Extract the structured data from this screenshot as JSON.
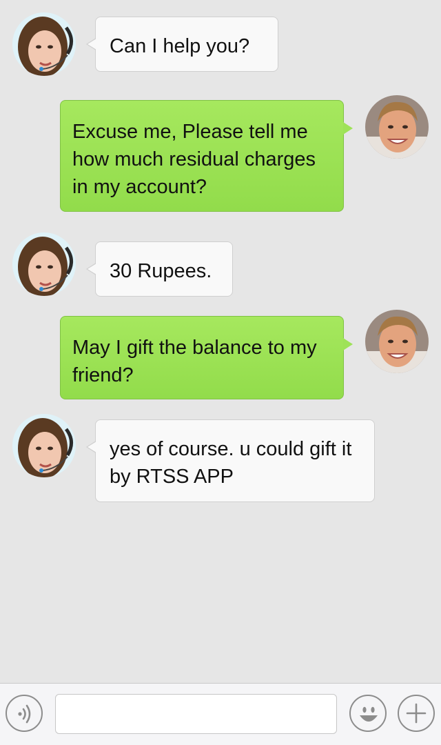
{
  "chat": {
    "messages": [
      {
        "sender": "agent",
        "text": "Can I help you?"
      },
      {
        "sender": "user",
        "text": "Excuse me, Please tell me how much residual charges in my account?"
      },
      {
        "sender": "agent",
        "text": "30 Rupees."
      },
      {
        "sender": "user",
        "text": "May I gift the balance to my friend?"
      },
      {
        "sender": "agent",
        "text": "yes of course. u could gift it by RTSS APP"
      }
    ]
  },
  "input_bar": {
    "message_value": "",
    "message_placeholder": "",
    "left_icon": "voice-icon",
    "emoji_icon": "emoji-icon",
    "plus_icon": "plus-icon"
  },
  "colors": {
    "background": "#e6e6e6",
    "incoming_bubble": "#f9f9f9",
    "outgoing_bubble": "#9ee257",
    "input_bar": "#f5f5f7",
    "icon_stroke": "#8c8c8c"
  }
}
